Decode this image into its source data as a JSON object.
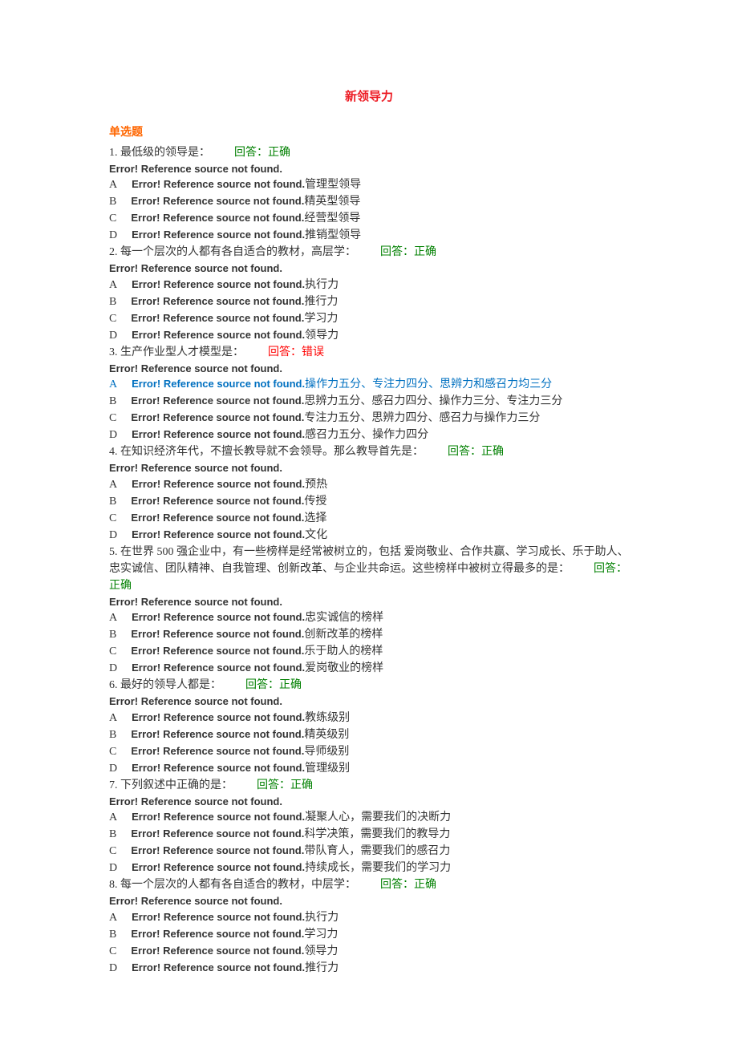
{
  "title": "新领导力",
  "section_label": "单选题",
  "error_text": "Error! Reference source not found.",
  "feedback_label_prefix": "回答：",
  "feedback_correct": "正确",
  "feedback_wrong": "错误",
  "questions": [
    {
      "num": "1.",
      "text": "最低级的领导是：",
      "feedback": "correct",
      "options": [
        {
          "letter": "A",
          "text": "管理型领导",
          "highlight": false
        },
        {
          "letter": "B",
          "text": "精英型领导",
          "highlight": false
        },
        {
          "letter": "C",
          "text": "经营型领导",
          "highlight": false
        },
        {
          "letter": "D",
          "text": "推销型领导",
          "highlight": false
        }
      ]
    },
    {
      "num": "2.",
      "text": "每一个层次的人都有各自适合的教材，高层学：",
      "feedback": "correct",
      "options": [
        {
          "letter": "A",
          "text": "执行力",
          "highlight": false
        },
        {
          "letter": "B",
          "text": "推行力",
          "highlight": false
        },
        {
          "letter": "C",
          "text": "学习力",
          "highlight": false
        },
        {
          "letter": "D",
          "text": "领导力",
          "highlight": false
        }
      ]
    },
    {
      "num": "3.",
      "text": "生产作业型人才模型是：",
      "feedback": "wrong",
      "options": [
        {
          "letter": "A",
          "text": "操作力五分、专注力四分、思辨力和感召力均三分",
          "highlight": true
        },
        {
          "letter": "B",
          "text": "思辨力五分、感召力四分、操作力三分、专注力三分",
          "highlight": false
        },
        {
          "letter": "C",
          "text": "专注力五分、思辨力四分、感召力与操作力三分",
          "highlight": false
        },
        {
          "letter": "D",
          "text": "感召力五分、操作力四分",
          "highlight": false
        }
      ]
    },
    {
      "num": "4.",
      "text": "在知识经济年代，不擅长教导就不会领导。那么教导首先是：",
      "feedback": "correct",
      "options": [
        {
          "letter": "A",
          "text": "预热",
          "highlight": false
        },
        {
          "letter": "B",
          "text": "传授",
          "highlight": false
        },
        {
          "letter": "C",
          "text": "选择",
          "highlight": false
        },
        {
          "letter": "D",
          "text": "文化",
          "highlight": false
        }
      ]
    },
    {
      "num": "5.",
      "text": "在世界 500 强企业中，有一些榜样是经常被树立的，包括 爱岗敬业、合作共赢、学习成长、乐于助人、忠实诚信、团队精神、自我管理、创新改革、与企业共命运。这些榜样中被树立得最多的是：",
      "feedback": "correct",
      "options": [
        {
          "letter": "A",
          "text": "忠实诚信的榜样",
          "highlight": false
        },
        {
          "letter": "B",
          "text": "创新改革的榜样",
          "highlight": false
        },
        {
          "letter": "C",
          "text": "乐于助人的榜样",
          "highlight": false
        },
        {
          "letter": "D",
          "text": "爱岗敬业的榜样",
          "highlight": false
        }
      ]
    },
    {
      "num": "6.",
      "text": "最好的领导人都是：",
      "feedback": "correct",
      "options": [
        {
          "letter": "A",
          "text": "教练级别",
          "highlight": false
        },
        {
          "letter": "B",
          "text": "精英级别",
          "highlight": false
        },
        {
          "letter": "C",
          "text": "导师级别",
          "highlight": false
        },
        {
          "letter": "D",
          "text": "管理级别",
          "highlight": false
        }
      ]
    },
    {
      "num": "7.",
      "text": "下列叙述中正确的是：",
      "feedback": "correct",
      "options": [
        {
          "letter": "A",
          "text": "凝聚人心，需要我们的决断力",
          "highlight": false
        },
        {
          "letter": "B",
          "text": "科学决策，需要我们的教导力",
          "highlight": false
        },
        {
          "letter": "C",
          "text": "带队育人，需要我们的感召力",
          "highlight": false
        },
        {
          "letter": "D",
          "text": "持续成长，需要我们的学习力",
          "highlight": false
        }
      ]
    },
    {
      "num": "8.",
      "text": "每一个层次的人都有各自适合的教材，中层学：",
      "feedback": "correct",
      "options": [
        {
          "letter": "A",
          "text": "执行力",
          "highlight": false
        },
        {
          "letter": "B",
          "text": "学习力",
          "highlight": false
        },
        {
          "letter": "C",
          "text": "领导力",
          "highlight": false
        },
        {
          "letter": "D",
          "text": "推行力",
          "highlight": false
        }
      ]
    }
  ]
}
